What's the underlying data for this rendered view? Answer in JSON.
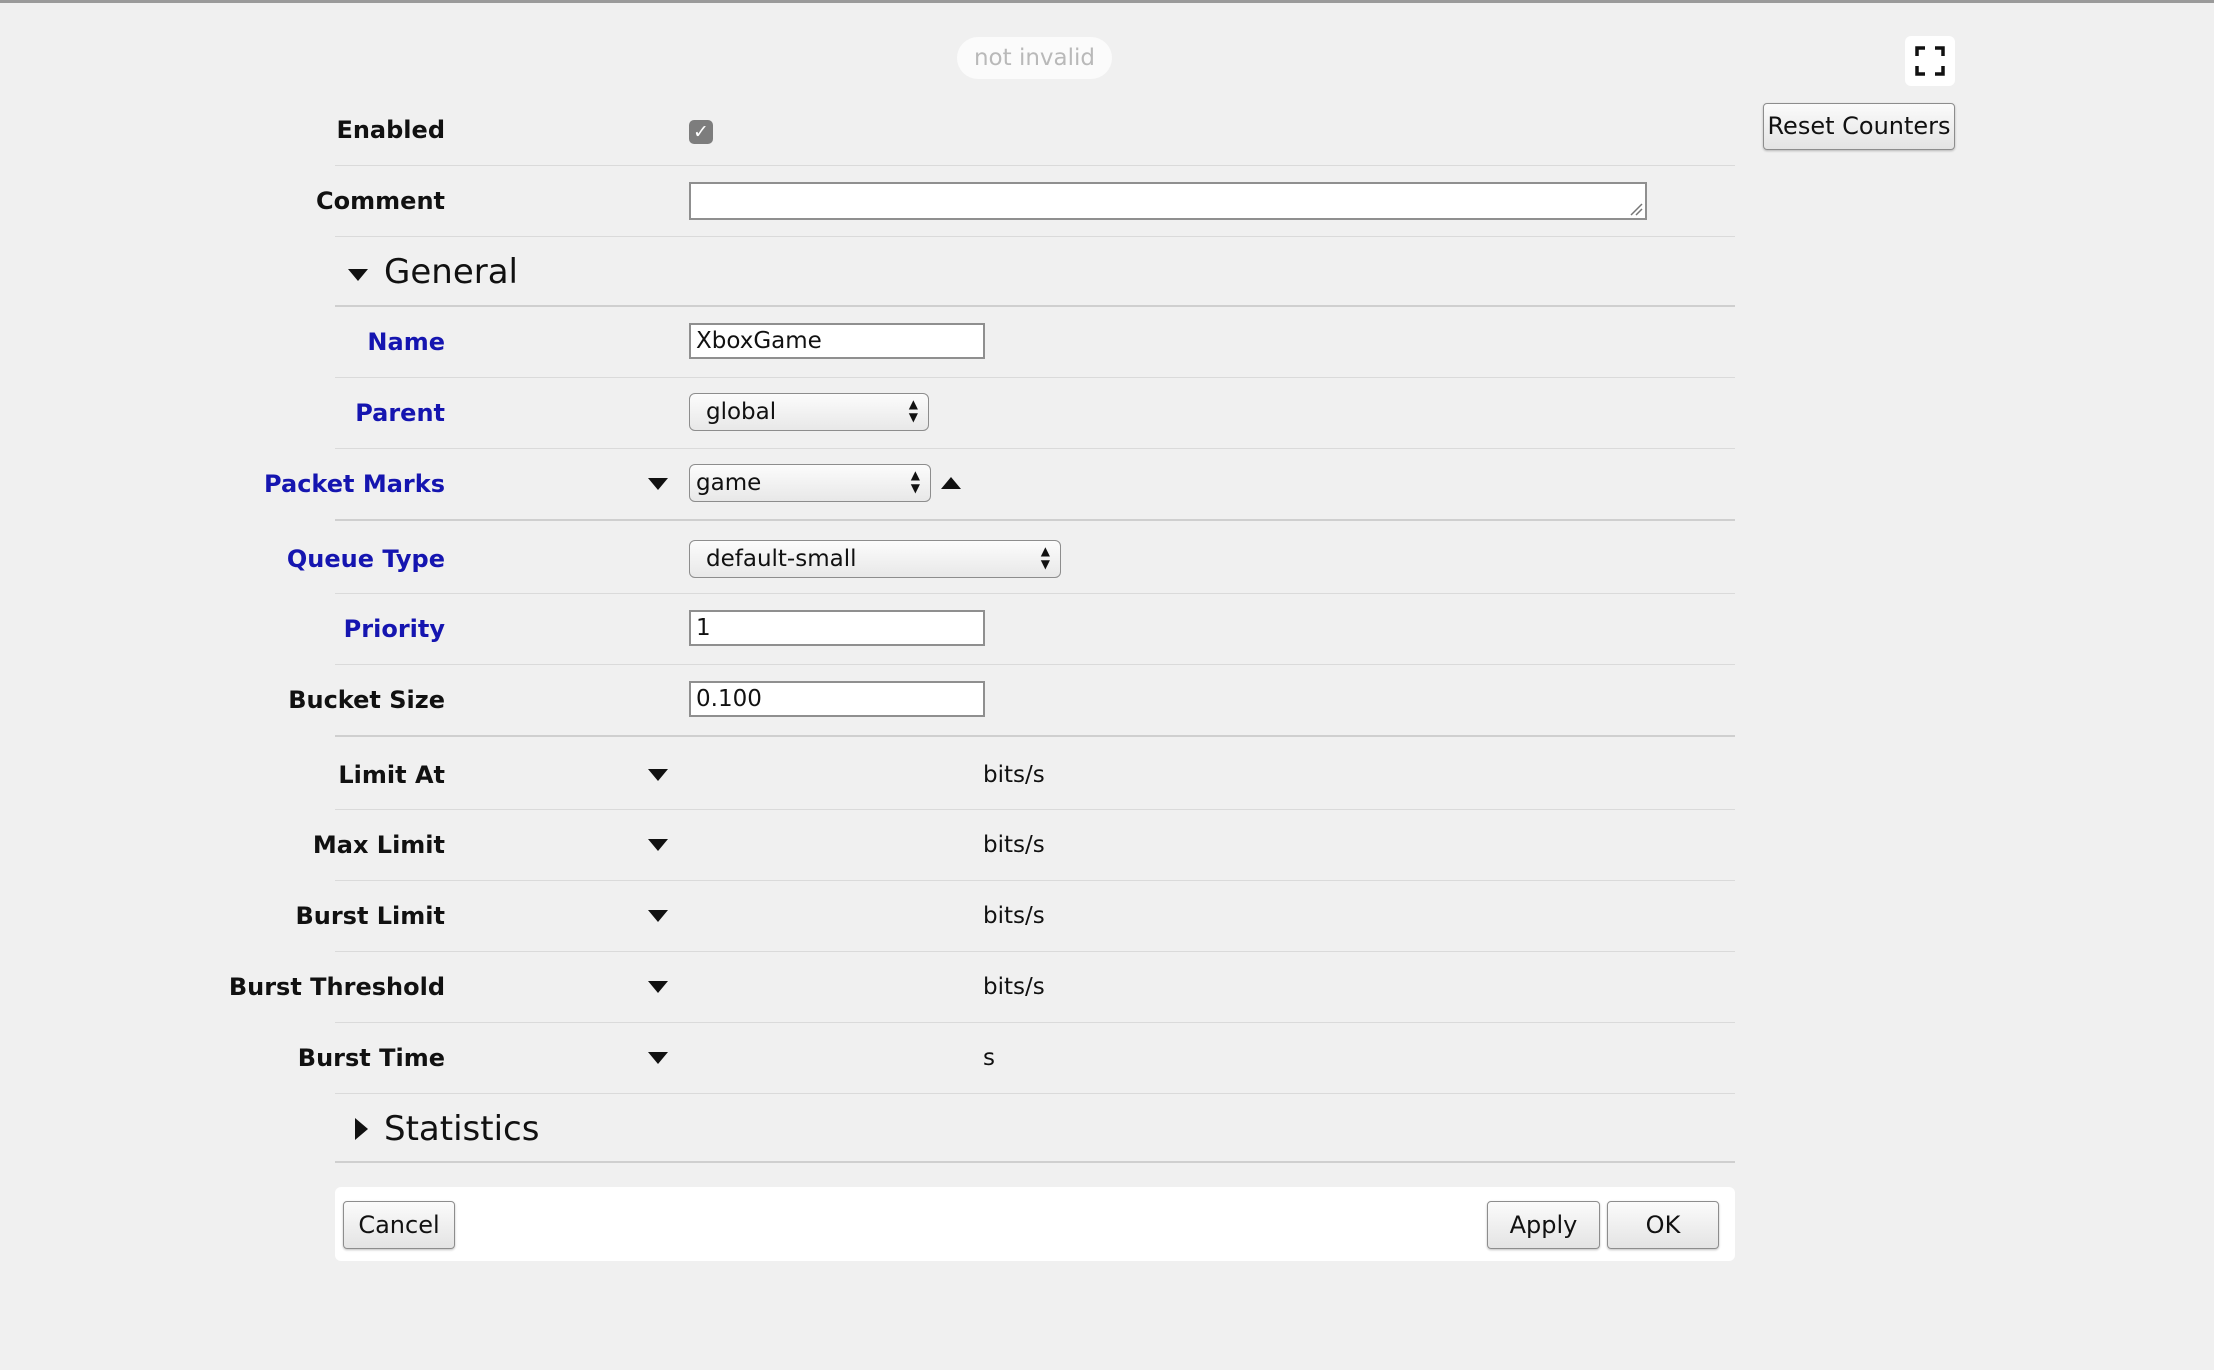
{
  "header": {
    "status_text": "not invalid",
    "reset_counters_label": "Reset Counters"
  },
  "form": {
    "enabled": {
      "label": "Enabled",
      "checked": true
    },
    "comment": {
      "label": "Comment",
      "value": ""
    },
    "general_section": {
      "title": "General",
      "expanded": true
    },
    "name": {
      "label": "Name",
      "value": "XboxGame"
    },
    "parent": {
      "label": "Parent",
      "value": "global"
    },
    "packet_marks": {
      "label": "Packet Marks",
      "value": "game"
    },
    "queue_type": {
      "label": "Queue Type",
      "value": "default-small"
    },
    "priority": {
      "label": "Priority",
      "value": "1"
    },
    "bucket_size": {
      "label": "Bucket Size",
      "value": "0.100"
    },
    "limit_at": {
      "label": "Limit At",
      "unit": "bits/s"
    },
    "max_limit": {
      "label": "Max Limit",
      "unit": "bits/s"
    },
    "burst_limit": {
      "label": "Burst Limit",
      "unit": "bits/s"
    },
    "burst_threshold": {
      "label": "Burst Threshold",
      "unit": "bits/s"
    },
    "burst_time": {
      "label": "Burst Time",
      "unit": "s"
    },
    "statistics_section": {
      "title": "Statistics",
      "expanded": false
    }
  },
  "footer": {
    "cancel_label": "Cancel",
    "apply_label": "Apply",
    "ok_label": "OK"
  },
  "colors": {
    "required_label": "#1515b0",
    "background": "#f0f0f0"
  },
  "icons": {
    "fullscreen": "fullscreen-icon",
    "section_expanded": "triangle-down-icon",
    "section_collapsed": "triangle-right-icon"
  }
}
